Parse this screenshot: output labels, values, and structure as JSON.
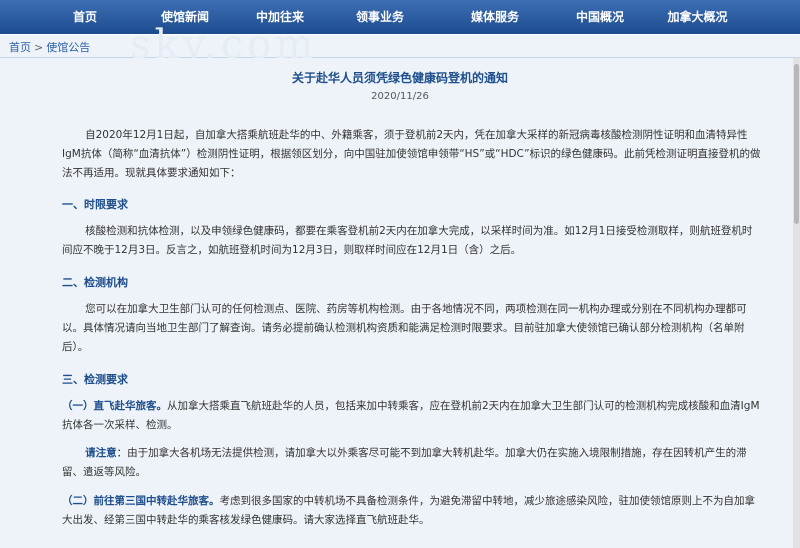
{
  "nav": {
    "items": [
      {
        "label": "首页"
      },
      {
        "label": "使馆新闻"
      },
      {
        "label": "中加往来"
      },
      {
        "label": "领事业务"
      },
      {
        "label": "媒体服务"
      },
      {
        "label": "中国概况"
      },
      {
        "label": "加拿大概况"
      }
    ]
  },
  "breadcrumb": {
    "home": "首页",
    "separator": ">",
    "current": "使馆公告"
  },
  "watermark": "sky.com",
  "article": {
    "title": "关于赴华人员须凭绿色健康码登机的通知",
    "date": "2020/11/26",
    "intro": "自2020年12月1日起，自加拿大搭乘航班赴华的中、外籍乘客，须于登机前2天内，凭在加拿大采样的新冠病毒核酸检测阴性证明和血清特异性IgM抗体（简称“血清抗体”）检测阴性证明，根据领区划分，向中国驻加使领馆申领带“HS”或“HDC”标识的绿色健康码。此前凭检测证明直接登机的做法不再适用。现就具体要求通知如下：",
    "s1_title": "一、时限要求",
    "s1_text": "核酸检测和抗体检测，以及申领绿色健康码，都要在乘客登机前2天内在加拿大完成，以采样时间为准。如12月1日接受检测取样，则航班登机时间应不晚于12月3日。反言之，如航班登机时间为12月3日，则取样时间应在12月1日（含）之后。",
    "s2_title": "二、检测机构",
    "s2_text": "您可以在加拿大卫生部门认可的任何检测点、医院、药房等机构检测。由于各地情况不同，两项检测在同一机构办理或分别在不同机构办理都可以。具体情况请向当地卫生部门了解查询。请务必提前确认检测机构资质和能满足检测时限要求。目前驻加拿大使领馆已确认部分检测机构（名单附后）。",
    "s3_title": "三、检测要求",
    "p1_bold": "（一）直飞赴华旅客。",
    "p1_text": "从加拿大搭乘直飞航班赴华的人员，包括来加中转乘客，应在登机前2天内在加拿大卫生部门认可的检测机构完成核酸和血清IgM抗体各一次采样、检测。",
    "note_bold": "请注意",
    "note_text": "：由于加拿大各机场无法提供检测，请加拿大以外乘客尽可能不到加拿大转机赴华。加拿大仍在实施入境限制措施，存在因转机产生的滞留、遣返等风险。",
    "p2_bold": "（二）前往第三国中转赴华旅客。",
    "p2_text": "考虑到很多国家的中转机场不具备检测条件，为避免滞留中转地，减少旅途感染风险，驻加使领馆原则上不为自加拿大出发、经第三国中转赴华的乘客核发绿色健康码。请大家选择直飞航班赴华。"
  }
}
